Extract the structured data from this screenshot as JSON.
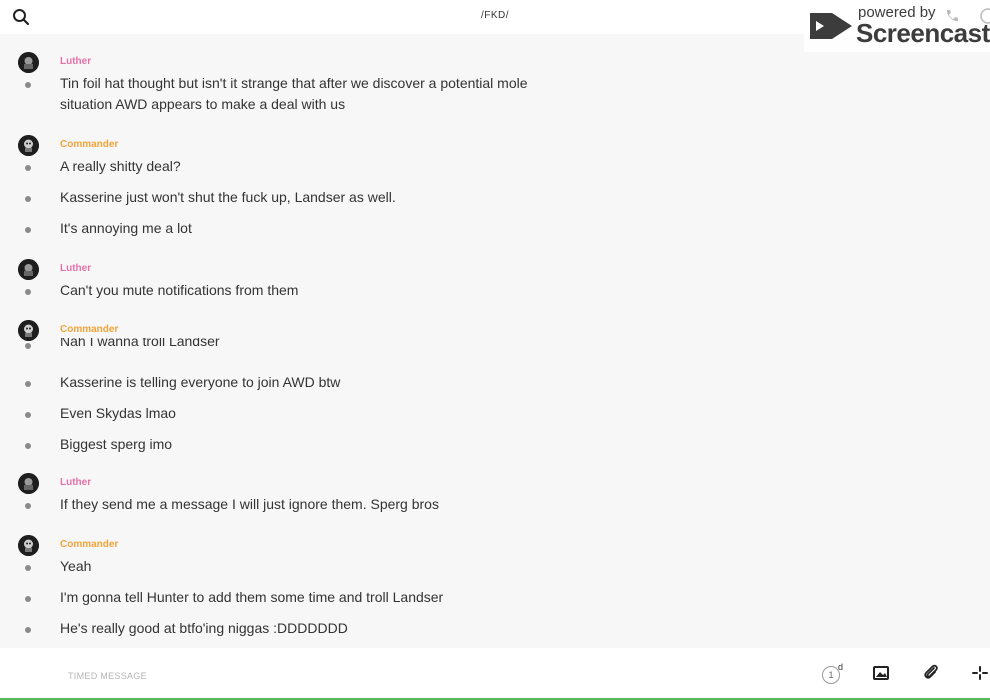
{
  "header": {
    "title": "/FKD/",
    "search_icon": "search-icon"
  },
  "watermark": {
    "powered_by": "powered by",
    "brand": "Screencastify",
    "icons": [
      "screencastify-logo-icon",
      "phone-icon",
      "info-icon"
    ]
  },
  "colors": {
    "luther": "#e671a8",
    "commander": "#f2a33a",
    "bullet": "#8a8a8a",
    "background": "#f7f7f7"
  },
  "groups": [
    {
      "author": "Luther",
      "messages": [
        "Tin foil hat thought but isn't it strange that after we discover a potential mole situation AWD appears to make a deal with us"
      ]
    },
    {
      "author": "Commander",
      "messages": [
        "A really shitty deal?",
        "Kasserine just won't shut the fuck up, Landser as well.",
        "It's annoying me a lot"
      ]
    },
    {
      "author": "Luther",
      "messages": [
        "Can't you mute notifications from them"
      ]
    },
    {
      "author": "Commander",
      "messages": [
        "Nah I wanna troll Landser",
        "Kasserine is telling everyone to join AWD btw",
        "Even Skydas lmao",
        "Biggest sperg imo"
      ]
    },
    {
      "author": "Luther",
      "messages": [
        "If they send me a message I will just ignore them. Sperg bros"
      ]
    },
    {
      "author": "Commander",
      "messages": [
        "Yeah",
        "I'm gonna tell Hunter to add them some time and troll Landser",
        "He's really good at btfo'ing niggas :DDDDDDD"
      ]
    }
  ],
  "composer": {
    "placeholder": "TIMED MESSAGE",
    "timer_value": "1",
    "timer_unit": "d",
    "icons": [
      "timer-icon",
      "image-icon",
      "paperclip-icon",
      "more-icon"
    ]
  }
}
